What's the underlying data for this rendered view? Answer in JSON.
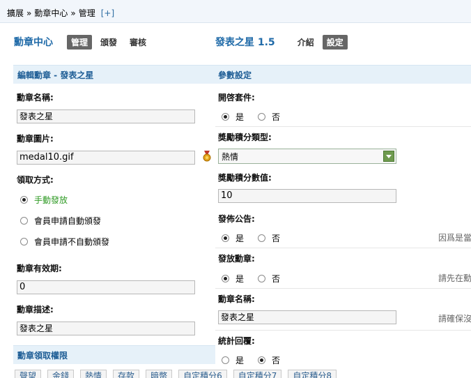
{
  "breadcrumb": {
    "items": [
      "擴展",
      "勳章中心",
      "管理"
    ],
    "separator": "»",
    "add": "[+]"
  },
  "nav_left": {
    "title": "勳章中心",
    "tabs": [
      "管理",
      "頒發",
      "審核"
    ],
    "active": 0
  },
  "nav_right": {
    "title": "發表之星 1.5",
    "tabs": [
      "介紹",
      "設定"
    ],
    "active": 1
  },
  "edit": {
    "header": "編輯勳章 - 發表之星",
    "name_label": "勳章名稱:",
    "name_value": "發表之星",
    "image_label": "勳章圖片:",
    "image_value": "medal10.gif",
    "method_label": "領取方式:",
    "methods": [
      "手動發放",
      "會員申請自動頒發",
      "會員申請不自動頒發"
    ],
    "method_selected": 0,
    "expiry_label": "勳章有效期:",
    "expiry_value": "0",
    "desc_label": "勳章描述:",
    "desc_value": "發表之星"
  },
  "params": {
    "header": "參數設定",
    "enable_label": "開啓套件:",
    "bonus_type_label": "獎勵積分類型:",
    "bonus_type_value": "熱情",
    "bonus_value_label": "獎勵積分數值:",
    "bonus_value": "10",
    "announce_label": "發佈公告:",
    "announce_hint": "因爲是當",
    "issue_label": "發放勳章:",
    "issue_hint": "請先在勳",
    "medal_name_label": "勳章名稱:",
    "medal_name_value": "發表之星",
    "medal_name_hint": "請確保沒",
    "stats_label": "統計回覆:",
    "yes": "是",
    "no": "否"
  },
  "permissions": {
    "header": "勳章領取權限",
    "buttons": [
      "聲望",
      "金錢",
      "熱情",
      "存款",
      "暗幣",
      "自定積分6",
      "自定積分7",
      "自定積分8"
    ]
  },
  "colors": {
    "accent": "#1f6aa8",
    "green": "#2e9a23",
    "section_bg": "#e6f1f9"
  },
  "icons": {
    "medal": "medal-icon"
  }
}
